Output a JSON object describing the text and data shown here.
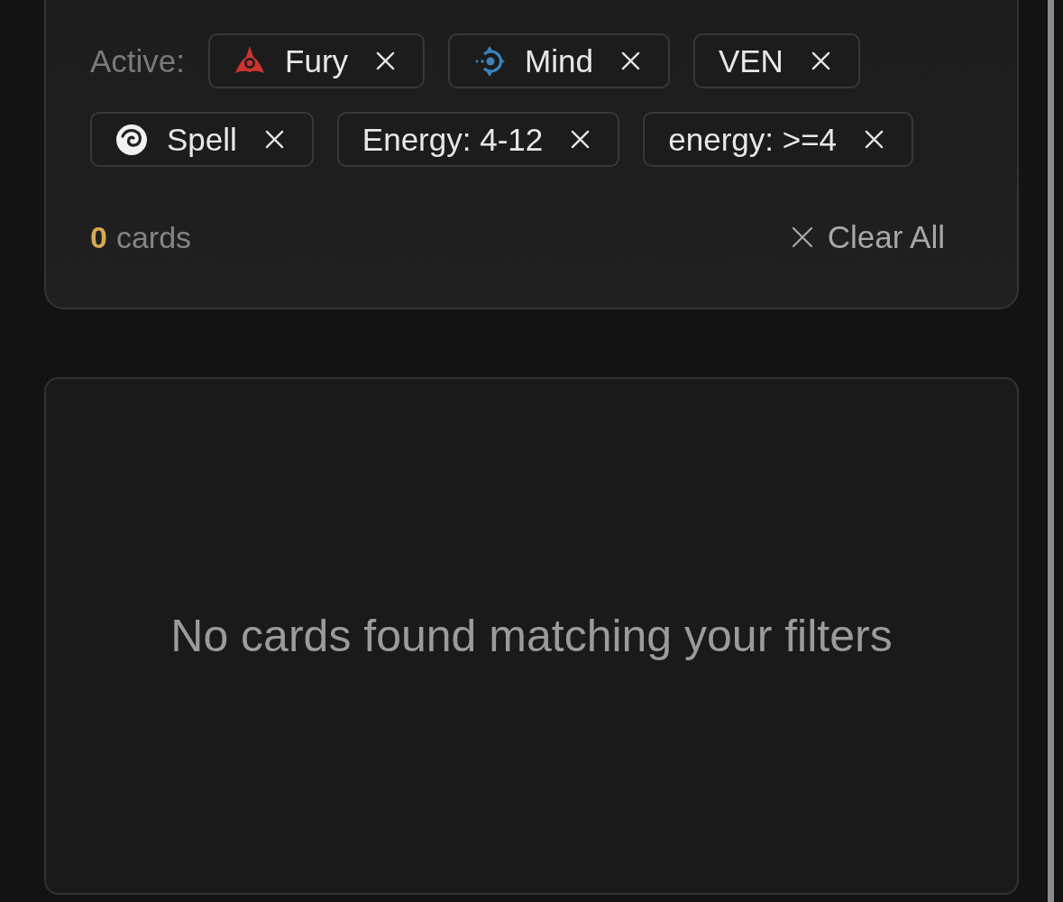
{
  "filter_panel": {
    "active_label": "Active:",
    "chips": [
      {
        "kind": "fury",
        "label": "Fury"
      },
      {
        "kind": "mind",
        "label": "Mind"
      },
      {
        "kind": "text",
        "label": "VEN"
      },
      {
        "kind": "spell",
        "label": "Spell"
      },
      {
        "kind": "text",
        "label": "Energy: 4-12"
      },
      {
        "kind": "text",
        "label": "energy: >=4"
      }
    ],
    "result_count": {
      "count": "0",
      "unit": "cards"
    },
    "clear_button": "Clear All"
  },
  "results": {
    "empty_message": "No cards found matching your filters"
  }
}
